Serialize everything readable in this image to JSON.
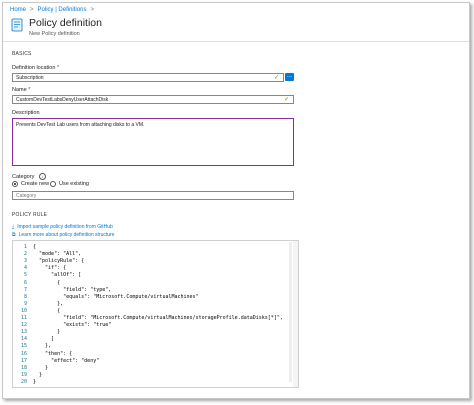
{
  "breadcrumb": {
    "home": "Home",
    "sep": ">",
    "defs": "Policy | Definitions"
  },
  "header": {
    "title": "Policy definition",
    "subtitle": "New Policy definition"
  },
  "basics": {
    "heading": "BASICS"
  },
  "definition_location": {
    "label": "Definition location",
    "required": "*",
    "value": "Subscription",
    "button": "..."
  },
  "name": {
    "label": "Name",
    "required": "*",
    "value": "CustomDevTestLabsDenyUserAttachDisk"
  },
  "description": {
    "label": "Description",
    "value": "Prevents DevTest Lab users from attaching disks to a VM."
  },
  "category": {
    "label": "Category",
    "info": "i",
    "options": [
      "Create new",
      "Use existing"
    ],
    "placeholder": "Category"
  },
  "policy_rule": {
    "heading": "POLICY RULE",
    "import_link": "Import sample policy definition from GitHub",
    "learn_link": "Learn more about policy definition structure"
  },
  "code": {
    "line_numbers": [
      "1",
      "2",
      "3",
      "4",
      "5",
      "6",
      "7",
      "8",
      "9",
      "10",
      "11",
      "12",
      "13",
      "14",
      "15",
      "16",
      "17",
      "18",
      "19",
      "20"
    ],
    "lines": [
      "{",
      "  \"mode\": \"All\",",
      "  \"policyRule\": {",
      "    \"if\": {",
      "      \"allOf\": [",
      "        {",
      "          \"field\": \"type\",",
      "          \"equals\": \"Microsoft.Compute/virtualMachines\"",
      "        },",
      "        {",
      "          \"field\": \"Microsoft.Compute/virtualMachines/storageProfile.dataDisks[*]\",",
      "          \"exists\": \"true\"",
      "        }",
      "      ]",
      "    },",
      "    \"then\": {",
      "      \"effect\": \"deny\"",
      "    }",
      "  }",
      "}"
    ]
  },
  "colors": {
    "accent": "#0078d4",
    "focus_border": "#8a2da5",
    "valid_check": "#57a300"
  }
}
